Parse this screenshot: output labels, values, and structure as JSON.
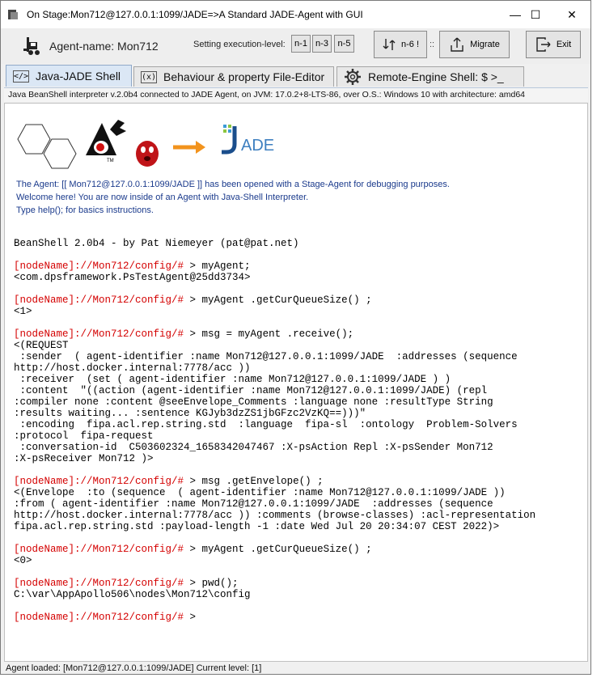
{
  "window": {
    "title": "On Stage:Mon712@127.0.0.1:1099/JADE=>A Standard JADE-Agent with GUI",
    "minimize_label": "—",
    "maximize_label": "☐",
    "close_label": "✕"
  },
  "toolbar": {
    "agent_name": "Agent-name: Mon712",
    "level_label": "Setting execution-level:",
    "level_buttons": [
      "n-1",
      "n-3",
      "n-5"
    ],
    "n6_label": "n-6 !",
    "separator": "::",
    "migrate_label": "Migrate",
    "exit_label": "Exit"
  },
  "tabs": [
    {
      "label": "Java-JADE Shell",
      "icon": "code-icon",
      "active": true
    },
    {
      "label": "Behaviour & property File-Editor",
      "icon": "function-icon",
      "active": false
    },
    {
      "label": "Remote-Engine Shell:   $ >_",
      "icon": "gear-icon",
      "active": false
    }
  ],
  "info_bar": "Java BeanShell interpreter v.2.0b4 connected to JADE Agent, on JVM: 17.0.2+8-LTS-86, over O.S.: Windows 10 with architecture: amd64",
  "logos": {
    "jade_text": "ADE",
    "tm": "TM"
  },
  "welcome": {
    "line1": "The Agent: [[ Mon712@127.0.0.1:1099/JADE ]] has been opened with a Stage-Agent for debugging purposes.",
    "line2": "Welcome here! You are now inside of an Agent with Java-Shell Interpreter.",
    "line3": "Type help(); for basics instructions."
  },
  "console": {
    "banner": "BeanShell 2.0b4 - by Pat Niemeyer (pat@pat.net)",
    "prompt": "[nodeName]://Mon712/config/#",
    "cmd1": " > myAgent;",
    "out1": "<com.dpsframework.PsTestAgent@25dd3734>",
    "cmd2": " > myAgent .getCurQueueSize() ;",
    "out2": "<1>",
    "cmd3": " > msg = myAgent .receive();",
    "out3": "<(REQUEST\n :sender  ( agent-identifier :name Mon712@127.0.0.1:1099/JADE  :addresses (sequence\nhttp://host.docker.internal:7778/acc ))\n :receiver  (set ( agent-identifier :name Mon712@127.0.0.1:1099/JADE ) )\n :content  \"((action (agent-identifier :name Mon712@127.0.0.1:1099/JADE) (repl\n:compiler none :content @seeEnvelope_Comments :language none :resultType String\n:results waiting... :sentence KGJyb3dzZS1jbGFzc2VzKQ==)))\"\n :encoding  fipa.acl.rep.string.std  :language  fipa-sl  :ontology  Problem-Solvers\n:protocol  fipa-request\n :conversation-id  C503602324_1658342047467 :X-psAction Repl :X-psSender Mon712\n:X-psReceiver Mon712 )>",
    "cmd4": " > msg .getEnvelope() ;",
    "out4": "<(Envelope  :to (sequence  ( agent-identifier :name Mon712@127.0.0.1:1099/JADE ))\n:from ( agent-identifier :name Mon712@127.0.0.1:1099/JADE  :addresses (sequence\nhttp://host.docker.internal:7778/acc )) :comments (browse-classes) :acl-representation\nfipa.acl.rep.string.std :payload-length -1 :date Wed Jul 20 20:34:07 CEST 2022)>",
    "cmd5": " > myAgent .getCurQueueSize() ;",
    "out5": "<0>",
    "cmd6": " > pwd();",
    "out6": "C:\\var\\AppApollo506\\nodes\\Mon712\\config",
    "cmd7": " >"
  },
  "statusbar": "Agent loaded: [Mon712@127.0.0.1:1099/JADE] Current level: [1]",
  "colors": {
    "prompt": "#d40000",
    "welcome": "#1a3a8c",
    "active_tab": "#dbe7f5"
  }
}
